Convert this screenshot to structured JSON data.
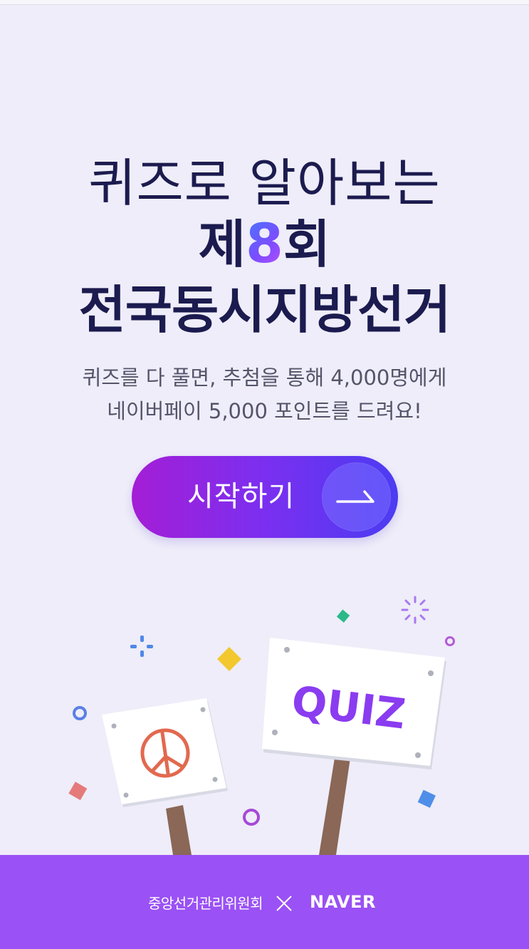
{
  "hero": {
    "line1": "퀴즈로 알아보는",
    "line2_prefix": "제",
    "line2_number": "8",
    "line2_suffix": "회",
    "line3": "전국동시지방선거"
  },
  "description": {
    "line1": "퀴즈를 다 풀면, 추첨을 통해 4,000명에게",
    "line2": "네이버페이 5,000 포인트를 드려요!"
  },
  "start_button": {
    "label": "시작하기"
  },
  "illustration": {
    "quiz_sign_text": "QUIZ",
    "left_sign_icon": "peace-icon"
  },
  "footer": {
    "organization": "중앙선거관리위원회",
    "partner": "NAVER"
  },
  "colors": {
    "background": "#eeedf9",
    "headline": "#1c1b4f",
    "footer": "#9a51f5",
    "button_start": "#a41ed6",
    "button_end": "#4b3cf2",
    "quiz_text": "#8a3cf0"
  }
}
